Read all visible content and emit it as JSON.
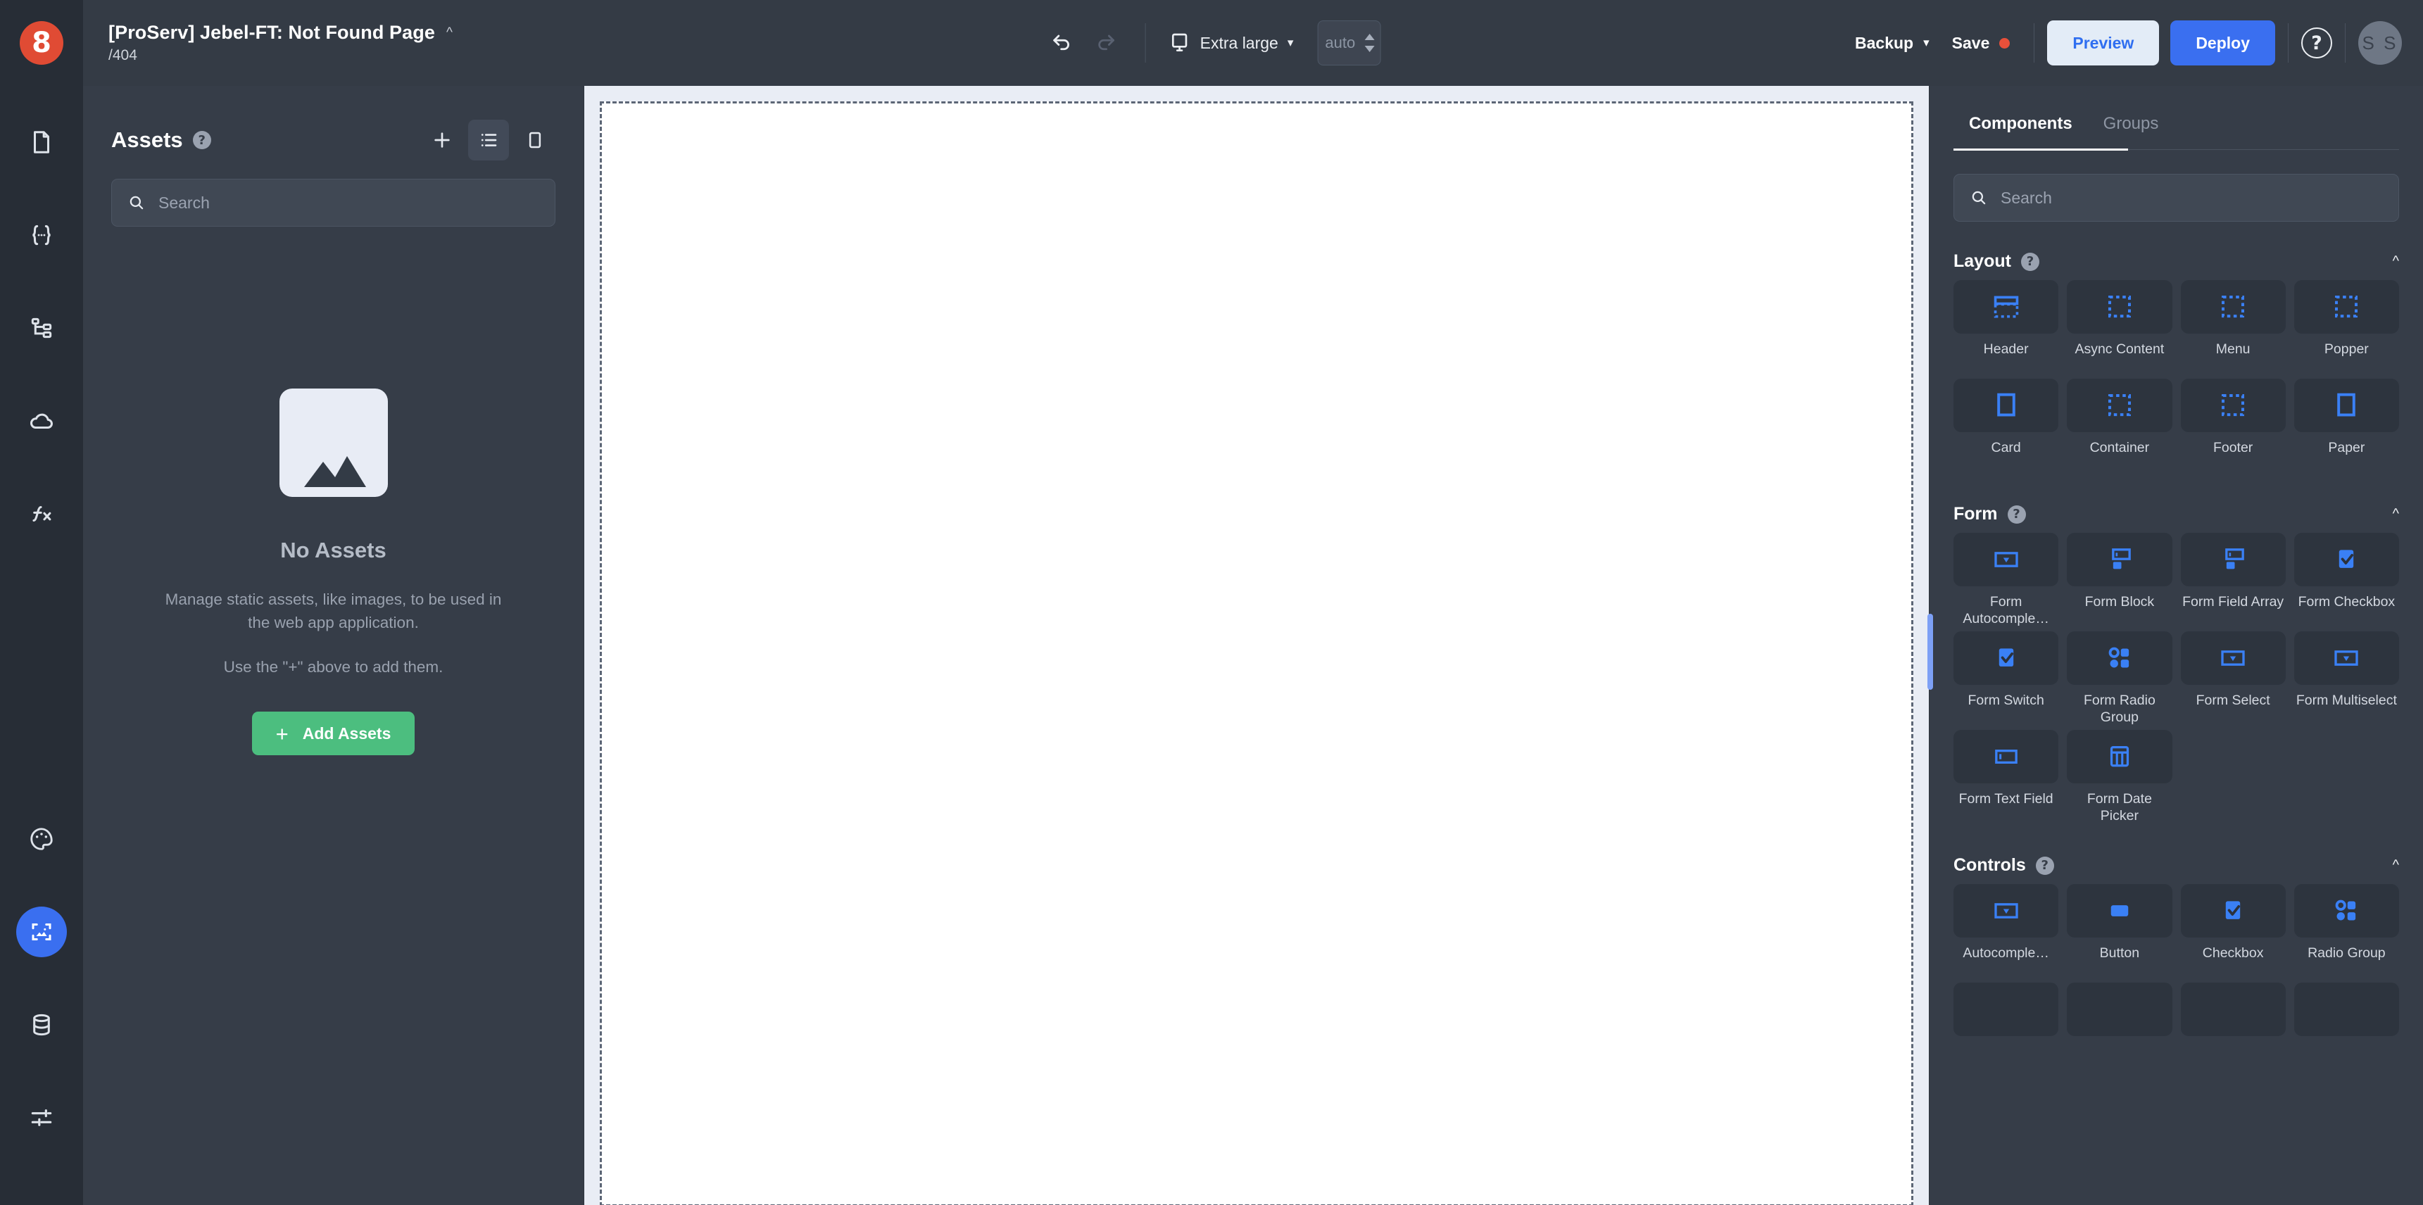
{
  "brand": {
    "logo_text": "8"
  },
  "header": {
    "title": "[ProServ] Jebel-FT: Not Found Page",
    "path": "/404",
    "collapse_icon": "chevron-up-icon",
    "undo_icon": "undo-icon",
    "redo_icon": "redo-icon",
    "breakpoint_icon": "monitor-icon",
    "breakpoint_label": "Extra large",
    "breakpoint_caret": "chevron-down-icon",
    "height_value": "auto",
    "backup_label": "Backup",
    "backup_caret": "chevron-down-icon",
    "save_label": "Save",
    "save_dirty": true,
    "preview_label": "Preview",
    "deploy_label": "Deploy",
    "help_label": "?",
    "avatar_initials": "S S"
  },
  "rail": {
    "items": [
      {
        "icon": "page-icon",
        "active": false
      },
      {
        "icon": "code-braces-icon",
        "active": false
      },
      {
        "icon": "sitemap-icon",
        "active": false
      },
      {
        "icon": "cloud-icon",
        "active": false
      },
      {
        "icon": "function-fx-icon",
        "active": false
      }
    ],
    "bottom_items": [
      {
        "icon": "palette-icon",
        "active": false
      },
      {
        "icon": "assets-image-icon",
        "active": true
      },
      {
        "icon": "database-icon",
        "active": false
      },
      {
        "icon": "sliders-settings-icon",
        "active": false
      }
    ]
  },
  "assets": {
    "title": "Assets",
    "help": "?",
    "add_icon": "plus-icon",
    "list_view_icon": "list-view-icon",
    "card_view_icon": "card-view-icon",
    "search_placeholder": "Search",
    "empty_title": "No Assets",
    "empty_desc": "Manage static assets, like images, to be used in the web app application.",
    "empty_hint": "Use the \"+\" above to add them.",
    "add_button_label": "Add Assets",
    "add_button_color": "#4cbe7f"
  },
  "components": {
    "tabs": [
      {
        "label": "Components",
        "active": true
      },
      {
        "label": "Groups",
        "active": false
      }
    ],
    "search_placeholder": "Search",
    "sections": [
      {
        "title": "Layout",
        "help": "?",
        "collapsed": false,
        "items": [
          {
            "label": "Header",
            "icon": "header-layout-icon"
          },
          {
            "label": "Async Content",
            "icon": "dashed-box-icon"
          },
          {
            "label": "Menu",
            "icon": "dashed-box-icon"
          },
          {
            "label": "Popper",
            "icon": "dashed-box-icon"
          },
          {
            "label": "Card",
            "icon": "solid-box-icon"
          },
          {
            "label": "Container",
            "icon": "dashed-box-icon"
          },
          {
            "label": "Footer",
            "icon": "dashed-box-icon"
          },
          {
            "label": "Paper",
            "icon": "solid-box-icon"
          }
        ]
      },
      {
        "title": "Form",
        "help": "?",
        "collapsed": false,
        "items": [
          {
            "label": "Form Autocomple…",
            "icon": "select-dropdown-icon"
          },
          {
            "label": "Form Block",
            "icon": "form-block-icon"
          },
          {
            "label": "Form Field Array",
            "icon": "form-block-icon"
          },
          {
            "label": "Form Checkbox",
            "icon": "checkbox-checked-icon"
          },
          {
            "label": "Form Switch",
            "icon": "checkbox-checked-icon"
          },
          {
            "label": "Form Radio Group",
            "icon": "radio-group-icon"
          },
          {
            "label": "Form Select",
            "icon": "select-dropdown-icon"
          },
          {
            "label": "Form Multiselect",
            "icon": "select-dropdown-icon"
          },
          {
            "label": "Form Text Field",
            "icon": "text-field-icon"
          },
          {
            "label": "Form Date Picker",
            "icon": "date-picker-icon"
          }
        ]
      },
      {
        "title": "Controls",
        "help": "?",
        "collapsed": false,
        "items": [
          {
            "label": "Autocomple…",
            "icon": "select-dropdown-icon"
          },
          {
            "label": "Button",
            "icon": "button-icon"
          },
          {
            "label": "Checkbox",
            "icon": "checkbox-checked-icon"
          },
          {
            "label": "Radio Group",
            "icon": "radio-group-icon"
          }
        ]
      }
    ],
    "accent_color": "#3a6ff0"
  }
}
